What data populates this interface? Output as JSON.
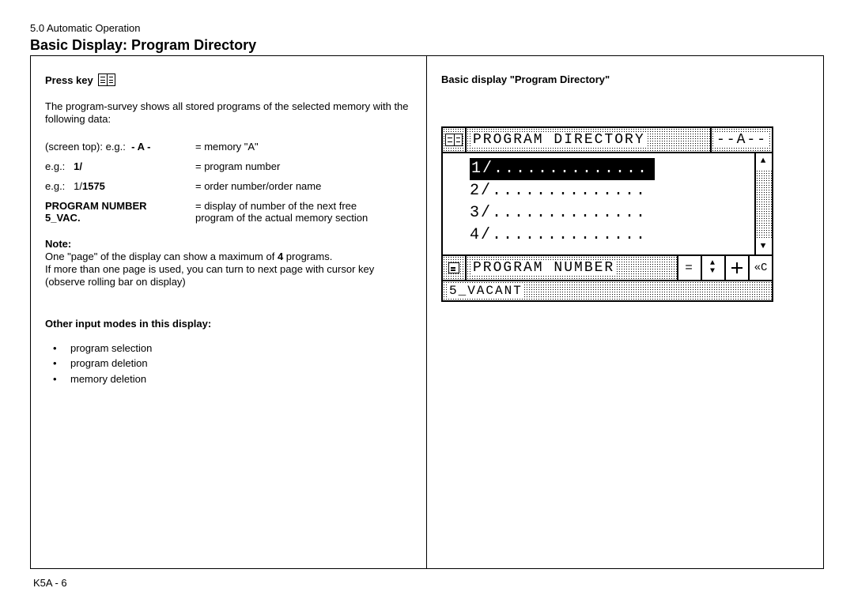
{
  "chapter": "5.0 Automatic Operation",
  "title": "Basic Display: Program Directory",
  "left": {
    "press_key": "Press key",
    "intro": "The program-survey shows all stored programs of the selected memory with the following data:",
    "rows": [
      {
        "k": "(screen top): e.g.:  - A -",
        "v": "= memory \"A\""
      },
      {
        "k": "e.g.:  1/",
        "kb": "1/",
        "v": "= program number"
      },
      {
        "k": "e.g.:  1/1575",
        "kb": "1575",
        "v": "= order number/order name"
      }
    ],
    "pn_label": "PROGRAM NUMBER",
    "vac_label": "5_VAC.",
    "vac_desc1": "= display of number of the next free",
    "vac_desc2": "program of the actual memory section",
    "note_head": "Note:",
    "note_l1": "One \"page\" of the display can show a maximum of 4 programs.",
    "note_l2": "If more than one page is used, you can turn to next page with cursor key",
    "note_l3": "(observe rolling bar on display)",
    "modes_head": "Other input modes in this display:",
    "modes": [
      "program selection",
      "program deletion",
      "memory deletion"
    ]
  },
  "right": {
    "caption": "Basic display \"Program Directory\"",
    "screen": {
      "title": "PROGRAM DIRECTORY",
      "memory": "--A--",
      "rows": [
        "1/..............",
        "2/..............",
        "3/..............",
        "4/.............."
      ],
      "prompt": "PROGRAM NUMBER",
      "vacant": "5_VACANT",
      "eq": "=",
      "clear": "«C"
    }
  },
  "footer": "K5A - 6"
}
